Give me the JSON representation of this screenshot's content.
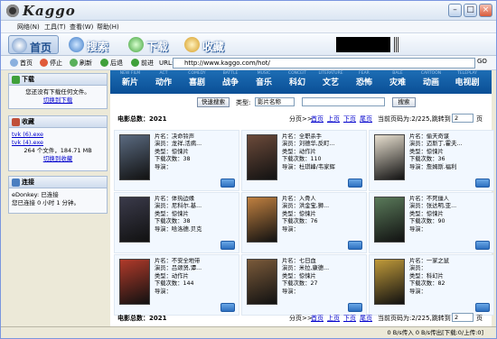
{
  "app": {
    "logo": "Kaggo"
  },
  "menu": [
    "网络(N)",
    "工具(T)",
    "查看(W)",
    "帮助(H)"
  ],
  "toolbar": {
    "home": "首页",
    "search": "搜索",
    "download": "下载",
    "favorites": "收藏"
  },
  "nav": {
    "home": "首页",
    "stop": "停止",
    "refresh": "刷新",
    "back": "后退",
    "forward": "前进",
    "url_label": "URL:",
    "url": "http://www.kaggo.com/hot/",
    "go": "GO"
  },
  "sidebar": {
    "download": {
      "title": "下载",
      "text": "您还没有下载任何文件。",
      "link": "切换到下载"
    },
    "favorites": {
      "title": "收藏",
      "files": [
        "tvk (6).exe",
        "tvk (4).exe"
      ],
      "summary": "264 个文件，184.71 MB",
      "link": "切换到收藏"
    },
    "connection": {
      "title": "连接",
      "status": "eDonkey: 已连接",
      "time": "您已连接 0 小时 1 分钟。"
    }
  },
  "categories": [
    {
      "en": "NEW FILM",
      "zh": "新片"
    },
    {
      "en": "ACT",
      "zh": "动作"
    },
    {
      "en": "COMEDY",
      "zh": "喜剧"
    },
    {
      "en": "BATTLE",
      "zh": "战争"
    },
    {
      "en": "MUSIC",
      "zh": "音乐"
    },
    {
      "en": "CONCEIT",
      "zh": "科幻"
    },
    {
      "en": "LITERATURE",
      "zh": "文艺"
    },
    {
      "en": "FEAR",
      "zh": "恐怖"
    },
    {
      "en": "BALE",
      "zh": "灾难"
    },
    {
      "en": "CARTOON",
      "zh": "动画"
    },
    {
      "en": "TELEPLAY",
      "zh": "电视剧"
    }
  ],
  "search": {
    "button": "快速搜索",
    "type_label": "类型:",
    "type_value": "影片名称",
    "submit": "搜索"
  },
  "stats": {
    "total": "电影总数：2021",
    "pagination_prefix": "分页>>",
    "first": "首页",
    "prev": "上页",
    "next": "下页",
    "last": "尾页",
    "page_info": "当前页码为:2/225,跳转到",
    "page_value": "2",
    "page_suffix": "页"
  },
  "labels": {
    "name": "片名：",
    "actor": "演员：",
    "type": "类型：",
    "downloads": "下载次数：",
    "director": "导演："
  },
  "movies": [
    {
      "title": "决命铃声",
      "actor": "龙祥,活病...",
      "type": "惊悚片",
      "downloads": "38",
      "director": ""
    },
    {
      "title": "全职杀手",
      "actor": "刘德华,反町...",
      "type": "动作片",
      "downloads": "110",
      "director": "杜琪峰/韦家辉"
    },
    {
      "title": "偷天奇谋",
      "actor": "迈斯丁,霍夫...",
      "type": "惊悚片",
      "downloads": "36",
      "director": "詹姆斯.福利"
    },
    {
      "title": "体热边缘",
      "actor": "尼科尔.基...",
      "type": "惊悚片",
      "downloads": "38",
      "director": "哈洛德.贝克"
    },
    {
      "title": "入骨人",
      "actor": "洪金宝,狮...",
      "type": "惊悚片",
      "downloads": "76",
      "director": ""
    },
    {
      "title": "不死僵人",
      "actor": "张达明,亚...",
      "type": "惊悚片",
      "downloads": "90",
      "director": ""
    },
    {
      "title": "不安全地带",
      "actor": "吕颂贤,谭...",
      "type": "动作片",
      "downloads": "144",
      "director": ""
    },
    {
      "title": "七日血",
      "actor": "米拉,康德...",
      "type": "惊悚片",
      "downloads": "27",
      "director": ""
    },
    {
      "title": "一家之鼠",
      "actor": "",
      "type": "科幻片",
      "downloads": "82",
      "director": ""
    }
  ],
  "status": {
    "text": "0 B/s传入 0 B/s传出[下载:0/上传:0]"
  },
  "colors": {
    "category_bar": "#0a4f96",
    "accent_blue": "#1d6db4",
    "link": "#0000cc"
  }
}
